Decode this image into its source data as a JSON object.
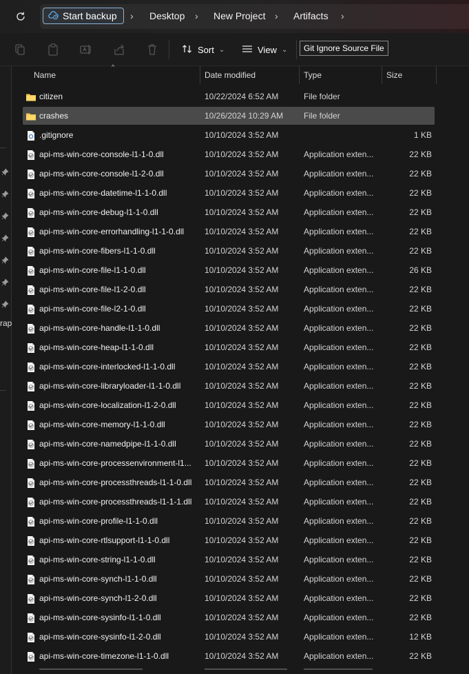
{
  "addressbar": {
    "refresh_icon": "refresh-icon",
    "breadcrumbs": [
      {
        "label": "Start backup",
        "icon": "cloud-backup-icon"
      },
      {
        "label": "Desktop"
      },
      {
        "label": "New Project"
      },
      {
        "label": "Artifacts"
      }
    ]
  },
  "toolbar": {
    "icons": [
      "cut-icon",
      "paste-icon",
      "rename-icon",
      "share-icon",
      "delete-icon"
    ],
    "sort_label": "Sort",
    "view_label": "View",
    "more_icon": "more-icon"
  },
  "nav": {
    "partial_label": "rap"
  },
  "columns": {
    "name": "Name",
    "date": "Date modified",
    "type": "Type",
    "size": "Size"
  },
  "tooltip": "Git Ignore Source File",
  "files": [
    {
      "name": "citizen",
      "date": "10/22/2024 6:52 AM",
      "type": "File folder",
      "size": "",
      "icon": "folder-icon"
    },
    {
      "name": "crashes",
      "date": "10/26/2024 10:29 AM",
      "type": "File folder",
      "size": "",
      "icon": "folder-icon",
      "selected": true
    },
    {
      "name": ".gitignore",
      "date": "10/10/2024 3:52 AM",
      "type": "",
      "size": "1 KB",
      "icon": "file-icon"
    },
    {
      "name": "api-ms-win-core-console-l1-1-0.dll",
      "date": "10/10/2024 3:52 AM",
      "type": "Application exten...",
      "size": "22 KB",
      "icon": "dll-file-icon"
    },
    {
      "name": "api-ms-win-core-console-l1-2-0.dll",
      "date": "10/10/2024 3:52 AM",
      "type": "Application exten...",
      "size": "22 KB",
      "icon": "dll-file-icon"
    },
    {
      "name": "api-ms-win-core-datetime-l1-1-0.dll",
      "date": "10/10/2024 3:52 AM",
      "type": "Application exten...",
      "size": "22 KB",
      "icon": "dll-file-icon"
    },
    {
      "name": "api-ms-win-core-debug-l1-1-0.dll",
      "date": "10/10/2024 3:52 AM",
      "type": "Application exten...",
      "size": "22 KB",
      "icon": "dll-file-icon"
    },
    {
      "name": "api-ms-win-core-errorhandling-l1-1-0.dll",
      "date": "10/10/2024 3:52 AM",
      "type": "Application exten...",
      "size": "22 KB",
      "icon": "dll-file-icon"
    },
    {
      "name": "api-ms-win-core-fibers-l1-1-0.dll",
      "date": "10/10/2024 3:52 AM",
      "type": "Application exten...",
      "size": "22 KB",
      "icon": "dll-file-icon"
    },
    {
      "name": "api-ms-win-core-file-l1-1-0.dll",
      "date": "10/10/2024 3:52 AM",
      "type": "Application exten...",
      "size": "26 KB",
      "icon": "dll-file-icon"
    },
    {
      "name": "api-ms-win-core-file-l1-2-0.dll",
      "date": "10/10/2024 3:52 AM",
      "type": "Application exten...",
      "size": "22 KB",
      "icon": "dll-file-icon"
    },
    {
      "name": "api-ms-win-core-file-l2-1-0.dll",
      "date": "10/10/2024 3:52 AM",
      "type": "Application exten...",
      "size": "22 KB",
      "icon": "dll-file-icon"
    },
    {
      "name": "api-ms-win-core-handle-l1-1-0.dll",
      "date": "10/10/2024 3:52 AM",
      "type": "Application exten...",
      "size": "22 KB",
      "icon": "dll-file-icon"
    },
    {
      "name": "api-ms-win-core-heap-l1-1-0.dll",
      "date": "10/10/2024 3:52 AM",
      "type": "Application exten...",
      "size": "22 KB",
      "icon": "dll-file-icon"
    },
    {
      "name": "api-ms-win-core-interlocked-l1-1-0.dll",
      "date": "10/10/2024 3:52 AM",
      "type": "Application exten...",
      "size": "22 KB",
      "icon": "dll-file-icon"
    },
    {
      "name": "api-ms-win-core-libraryloader-l1-1-0.dll",
      "date": "10/10/2024 3:52 AM",
      "type": "Application exten...",
      "size": "22 KB",
      "icon": "dll-file-icon"
    },
    {
      "name": "api-ms-win-core-localization-l1-2-0.dll",
      "date": "10/10/2024 3:52 AM",
      "type": "Application exten...",
      "size": "22 KB",
      "icon": "dll-file-icon"
    },
    {
      "name": "api-ms-win-core-memory-l1-1-0.dll",
      "date": "10/10/2024 3:52 AM",
      "type": "Application exten...",
      "size": "22 KB",
      "icon": "dll-file-icon"
    },
    {
      "name": "api-ms-win-core-namedpipe-l1-1-0.dll",
      "date": "10/10/2024 3:52 AM",
      "type": "Application exten...",
      "size": "22 KB",
      "icon": "dll-file-icon"
    },
    {
      "name": "api-ms-win-core-processenvironment-l1...",
      "date": "10/10/2024 3:52 AM",
      "type": "Application exten...",
      "size": "22 KB",
      "icon": "dll-file-icon"
    },
    {
      "name": "api-ms-win-core-processthreads-l1-1-0.dll",
      "date": "10/10/2024 3:52 AM",
      "type": "Application exten...",
      "size": "22 KB",
      "icon": "dll-file-icon"
    },
    {
      "name": "api-ms-win-core-processthreads-l1-1-1.dll",
      "date": "10/10/2024 3:52 AM",
      "type": "Application exten...",
      "size": "22 KB",
      "icon": "dll-file-icon"
    },
    {
      "name": "api-ms-win-core-profile-l1-1-0.dll",
      "date": "10/10/2024 3:52 AM",
      "type": "Application exten...",
      "size": "22 KB",
      "icon": "dll-file-icon"
    },
    {
      "name": "api-ms-win-core-rtlsupport-l1-1-0.dll",
      "date": "10/10/2024 3:52 AM",
      "type": "Application exten...",
      "size": "22 KB",
      "icon": "dll-file-icon"
    },
    {
      "name": "api-ms-win-core-string-l1-1-0.dll",
      "date": "10/10/2024 3:52 AM",
      "type": "Application exten...",
      "size": "22 KB",
      "icon": "dll-file-icon"
    },
    {
      "name": "api-ms-win-core-synch-l1-1-0.dll",
      "date": "10/10/2024 3:52 AM",
      "type": "Application exten...",
      "size": "22 KB",
      "icon": "dll-file-icon"
    },
    {
      "name": "api-ms-win-core-synch-l1-2-0.dll",
      "date": "10/10/2024 3:52 AM",
      "type": "Application exten...",
      "size": "22 KB",
      "icon": "dll-file-icon"
    },
    {
      "name": "api-ms-win-core-sysinfo-l1-1-0.dll",
      "date": "10/10/2024 3:52 AM",
      "type": "Application exten...",
      "size": "22 KB",
      "icon": "dll-file-icon"
    },
    {
      "name": "api-ms-win-core-sysinfo-l1-2-0.dll",
      "date": "10/10/2024 3:52 AM",
      "type": "Application exten...",
      "size": "12 KB",
      "icon": "dll-file-icon"
    },
    {
      "name": "api-ms-win-core-timezone-l1-1-0.dll",
      "date": "10/10/2024 3:52 AM",
      "type": "Application exten...",
      "size": "22 KB",
      "icon": "dll-file-icon"
    }
  ]
}
